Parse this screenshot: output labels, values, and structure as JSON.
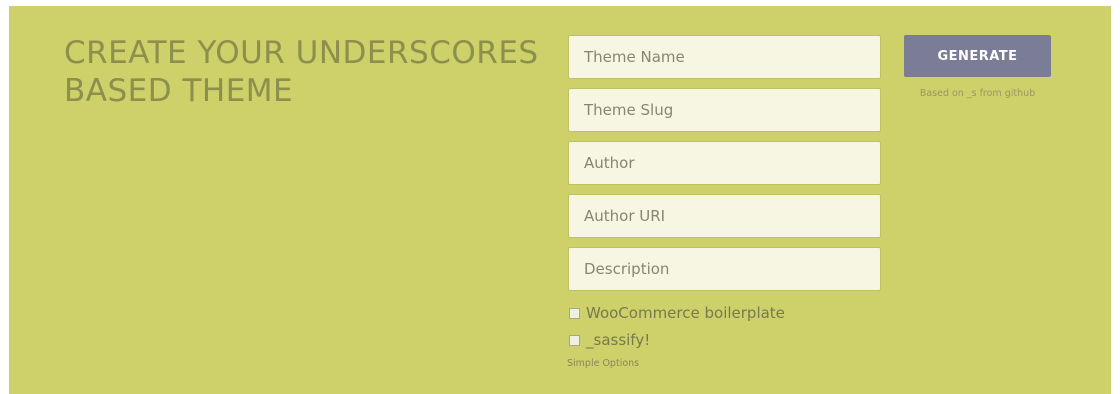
{
  "header": {
    "title": "CREATE YOUR UNDERSCORES BASED THEME"
  },
  "form": {
    "theme_name_placeholder": "Theme Name",
    "theme_slug_placeholder": "Theme Slug",
    "author_placeholder": "Author",
    "author_uri_placeholder": "Author URI",
    "description_placeholder": "Description",
    "options": [
      {
        "label": "WooCommerce boilerplate",
        "checked": false
      },
      {
        "label": "_sassify!",
        "checked": false
      }
    ],
    "simple_options_label": "Simple Options"
  },
  "generate": {
    "button_label": "GENERATE",
    "note": "Based on _s from github"
  },
  "colors": {
    "background": "#ced169",
    "input_bg": "#f6f6e3",
    "button": "#7b7d97",
    "title": "#8d8f4c"
  }
}
